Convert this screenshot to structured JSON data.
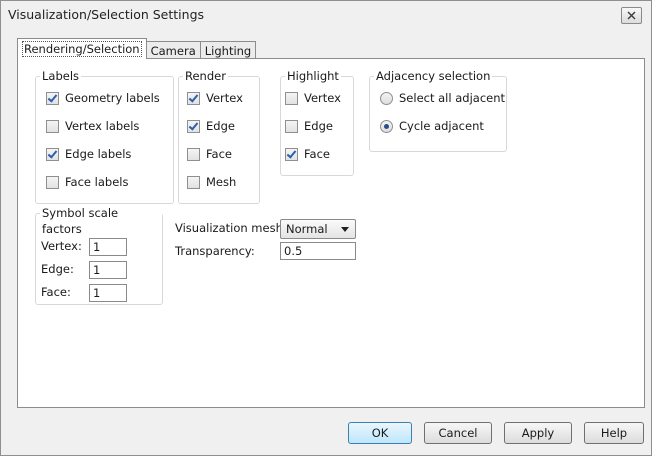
{
  "window": {
    "title": "Visualization/Selection Settings"
  },
  "tabs": [
    {
      "label": "Rendering/Selection",
      "active": true
    },
    {
      "label": "Camera",
      "active": false
    },
    {
      "label": "Lighting",
      "active": false
    }
  ],
  "labels_group": {
    "title": "Labels",
    "items": [
      {
        "label": "Geometry labels",
        "checked": true
      },
      {
        "label": "Vertex labels",
        "checked": false
      },
      {
        "label": "Edge labels",
        "checked": true
      },
      {
        "label": "Face labels",
        "checked": false
      }
    ]
  },
  "render_group": {
    "title": "Render",
    "items": [
      {
        "label": "Vertex",
        "checked": true
      },
      {
        "label": "Edge",
        "checked": true
      },
      {
        "label": "Face",
        "checked": false
      },
      {
        "label": "Mesh",
        "checked": false
      }
    ]
  },
  "highlight_group": {
    "title": "Highlight",
    "items": [
      {
        "label": "Vertex",
        "checked": false
      },
      {
        "label": "Edge",
        "checked": false
      },
      {
        "label": "Face",
        "checked": true
      }
    ]
  },
  "adjacency_group": {
    "title": "Adjacency selection",
    "items": [
      {
        "label": "Select all adjacent",
        "selected": false
      },
      {
        "label": "Cycle adjacent",
        "selected": true
      }
    ]
  },
  "symbol_scale": {
    "title": "Symbol scale factors",
    "vertex_label": "Vertex:",
    "vertex_value": "1",
    "edge_label": "Edge:",
    "edge_value": "1",
    "face_label": "Face:",
    "face_value": "1"
  },
  "visualization": {
    "mesh_label": "Visualization mesh:",
    "mesh_value": "Normal",
    "transparency_label": "Transparency:",
    "transparency_value": "0.5"
  },
  "buttons": {
    "ok": "OK",
    "cancel": "Cancel",
    "apply": "Apply",
    "help": "Help"
  },
  "colors": {
    "check": "#2b5fae",
    "default_button": "#bee6fd",
    "panel": "#ffffff",
    "dialog": "#f0f0f0"
  }
}
